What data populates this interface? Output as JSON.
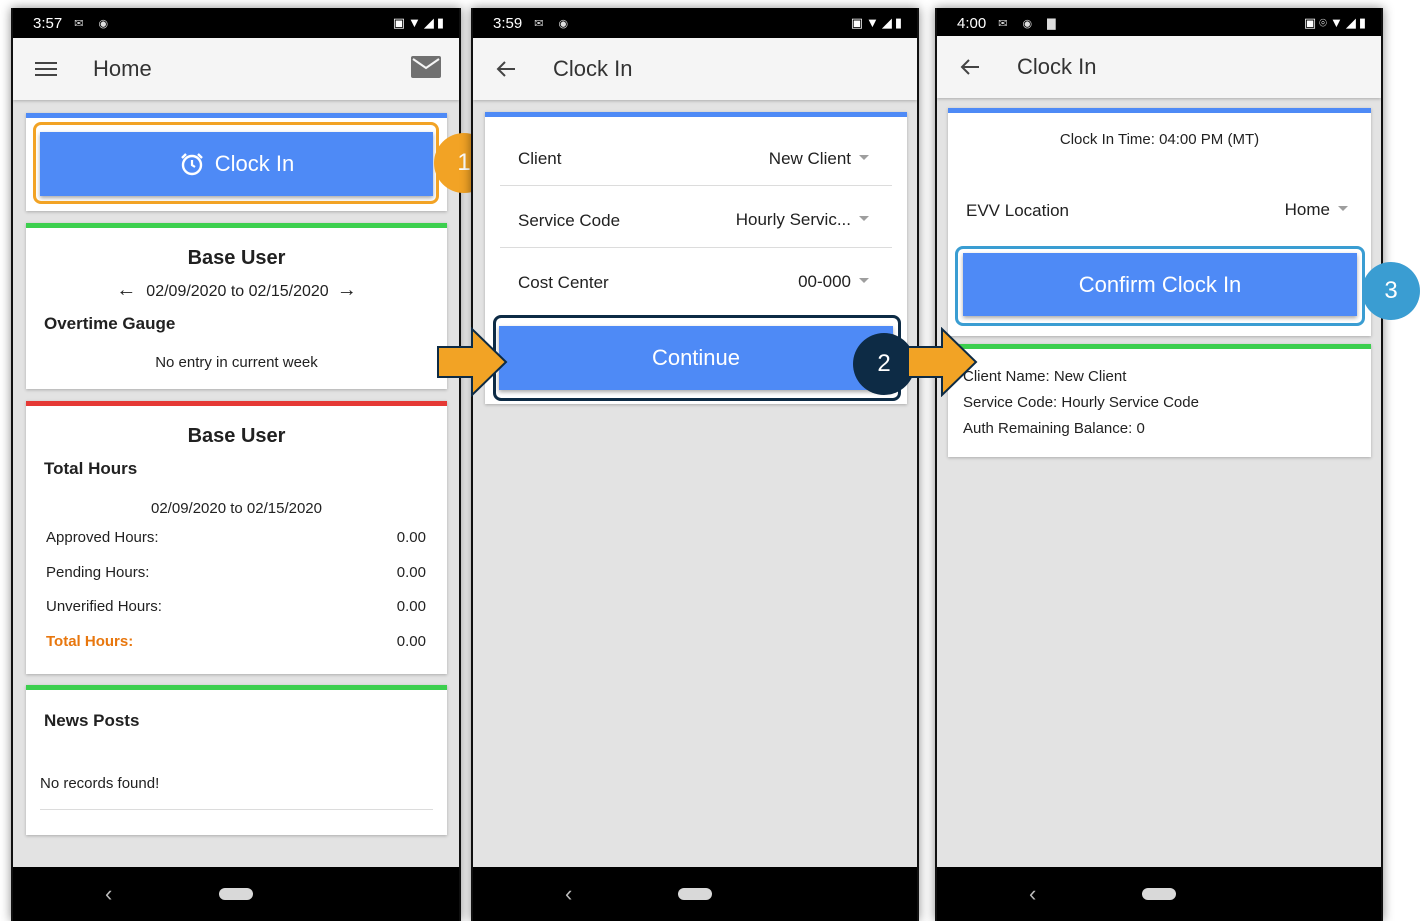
{
  "colors": {
    "accent_blue": "#4e8af6",
    "orange": "#f2a325",
    "navy": "#0d2b45",
    "teal": "#3a9dd2",
    "green": "#3ccf4e",
    "red": "#e53935",
    "total_orange": "#e8770e"
  },
  "screen1": {
    "status_time": "3:57",
    "title": "Home",
    "clock_in_label": "Clock In",
    "badge": "1",
    "user_card": {
      "name": "Base User",
      "date_range": "02/09/2020 to 02/15/2020",
      "gauge_label": "Overtime Gauge",
      "empty_msg": "No entry in current week"
    },
    "hours_card": {
      "name": "Base User",
      "section": "Total Hours",
      "date_range": "02/09/2020 to 02/15/2020",
      "rows": [
        {
          "label": "Approved Hours:",
          "value": "0.00"
        },
        {
          "label": "Pending Hours:",
          "value": "0.00"
        },
        {
          "label": "Unverified Hours:",
          "value": "0.00"
        },
        {
          "label": "Total Hours:",
          "value": "0.00"
        }
      ]
    },
    "news_card": {
      "title": "News Posts",
      "empty_msg": "No records found!"
    }
  },
  "screen2": {
    "status_time": "3:59",
    "title": "Clock In",
    "fields": [
      {
        "label": "Client",
        "value": "New Client"
      },
      {
        "label": "Service Code",
        "value": "Hourly Servic..."
      },
      {
        "label": "Cost Center",
        "value": "00-000"
      }
    ],
    "continue_label": "Continue",
    "badge": "2"
  },
  "screen3": {
    "status_time": "4:00",
    "title": "Clock In",
    "clock_in_time": "Clock In Time: 04:00 PM (MT)",
    "evv_label": "EVV Location",
    "evv_value": "Home",
    "confirm_label": "Confirm Clock In",
    "badge": "3",
    "info": [
      "Client Name: New Client",
      "Service Code: Hourly Service Code",
      "Auth Remaining Balance: 0"
    ]
  }
}
